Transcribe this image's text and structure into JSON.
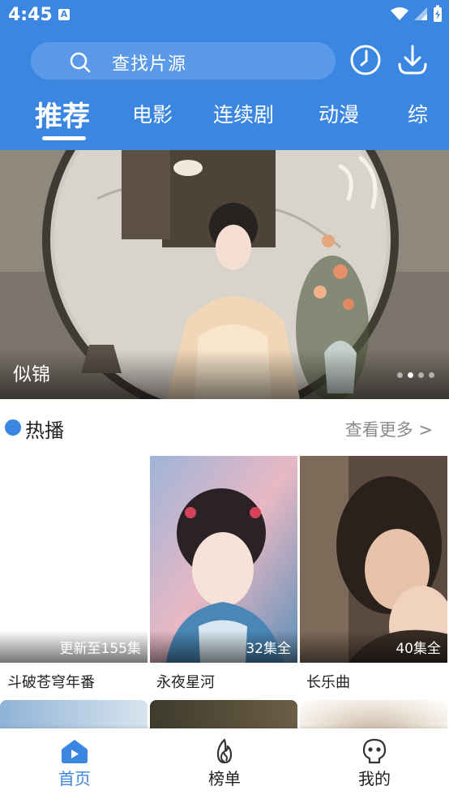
{
  "status": {
    "time": "4:45",
    "notif_letter": "A"
  },
  "search": {
    "placeholder": "查找片源"
  },
  "header": {
    "history_icon": "clock-icon",
    "download_icon": "download-icon"
  },
  "tabs": [
    {
      "label": "推荐",
      "active": true
    },
    {
      "label": "电影"
    },
    {
      "label": "连续剧"
    },
    {
      "label": "动漫"
    },
    {
      "label": "综"
    }
  ],
  "banner": {
    "title": "似锦",
    "slides": 4,
    "active_slide": 1
  },
  "section": {
    "title": "热播",
    "more": "查看更多 >"
  },
  "cards": [
    {
      "title": "斗破苍穹年番",
      "badge": "更新至155集"
    },
    {
      "title": "永夜星河",
      "badge": "32集全"
    },
    {
      "title": "长乐曲",
      "badge": "40集全"
    }
  ],
  "nav": [
    {
      "label": "首页",
      "icon": "home-play-icon",
      "active": true
    },
    {
      "label": "榜单",
      "icon": "flame-icon"
    },
    {
      "label": "我的",
      "icon": "profile-icon"
    }
  ],
  "colors": {
    "primary": "#3a86e0"
  }
}
